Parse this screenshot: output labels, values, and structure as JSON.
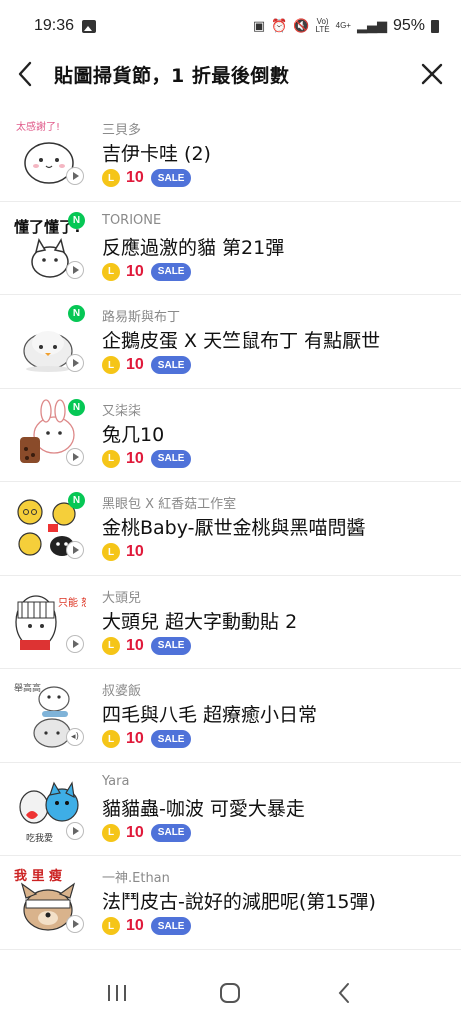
{
  "status_bar": {
    "time": "19:36",
    "network_top": "Vo)",
    "network_bottom": "LTE",
    "signal_top": "4G+",
    "battery": "95%"
  },
  "header": {
    "title": "貼圖掃貨節，1 折最後倒數"
  },
  "items": [
    {
      "author": "三貝多",
      "title": "吉伊卡哇 (2)",
      "price": "10",
      "sale": "SALE",
      "new": false,
      "media": "play",
      "thumb_text": "太感謝了!"
    },
    {
      "author": "TORIONE",
      "title": "反應過激的貓 第21彈",
      "price": "10",
      "sale": "SALE",
      "new": true,
      "new_label": "N",
      "media": "play",
      "thumb_text": "懂了懂了!"
    },
    {
      "author": "路易斯與布丁",
      "title": "企鵝皮蛋 X 天竺鼠布丁 有點厭世",
      "price": "10",
      "sale": "SALE",
      "new": true,
      "new_label": "N",
      "media": "play"
    },
    {
      "author": "又柒柒",
      "title": "兔几10",
      "price": "10",
      "sale": "SALE",
      "new": true,
      "new_label": "N",
      "media": "play"
    },
    {
      "author": "黑眼包 X 紅香菇工作室",
      "title": "金桃Baby-厭世金桃與黑喵問醬",
      "price": "10",
      "sale": null,
      "new": true,
      "new_label": "N",
      "media": "play"
    },
    {
      "author": "大頭兒",
      "title": "大頭兒 超大字動動貼 2",
      "price": "10",
      "sale": "SALE",
      "new": false,
      "media": "play",
      "thumb_text": "只能 怒吃"
    },
    {
      "author": "叔婆飯",
      "title": "四毛與八毛 超療癒小日常",
      "price": "10",
      "sale": "SALE",
      "new": false,
      "media": "sound",
      "thumb_text": "舉高高"
    },
    {
      "author": "Yara",
      "title": "貓貓蟲-咖波 可愛大暴走",
      "price": "10",
      "sale": "SALE",
      "new": false,
      "media": "play",
      "thumb_text": "吃我愛"
    },
    {
      "author": "一神.Ethan",
      "title": "法鬥皮古-說好的減肥呢(第15彈)",
      "price": "10",
      "sale": "SALE",
      "new": false,
      "media": "play",
      "thumb_text": "我 里 瘦"
    }
  ],
  "coin_label": "L",
  "colors": {
    "price": "#e0193a",
    "sale_badge": "#4f72d9",
    "new_badge": "#06c755",
    "coin": "#f5c518"
  }
}
